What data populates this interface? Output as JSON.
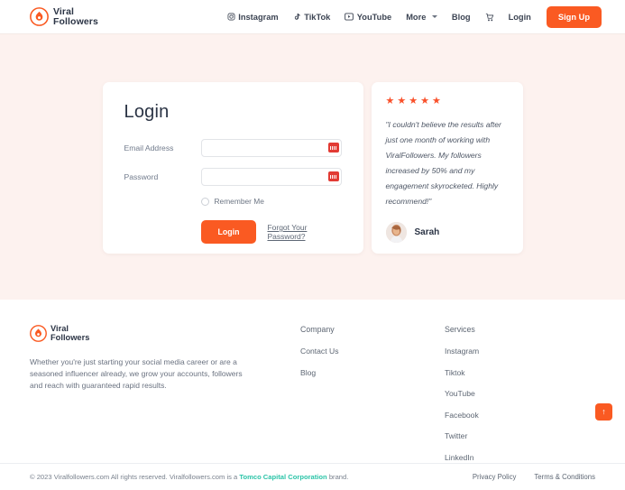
{
  "brand": {
    "name_line1": "Viral",
    "name_line2": "Followers",
    "accent_color": "#fa5a22",
    "logo_icon": "flame-droplet-icon"
  },
  "header": {
    "nav": [
      {
        "label": "Instagram",
        "icon": "instagram-icon"
      },
      {
        "label": "TikTok",
        "icon": "tiktok-icon"
      },
      {
        "label": "YouTube",
        "icon": "youtube-icon"
      },
      {
        "label": "More",
        "icon": "chevron-down-icon"
      },
      {
        "label": "Blog",
        "icon": ""
      },
      {
        "label": "",
        "icon": "cart-icon"
      },
      {
        "label": "Login",
        "icon": ""
      }
    ],
    "signup_label": "Sign Up"
  },
  "login": {
    "title": "Login",
    "email_label": "Email Address",
    "email_value": "",
    "email_placeholder": "",
    "password_label": "Password",
    "password_value": "",
    "password_placeholder": "",
    "remember_label": "Remember Me",
    "remember_checked": false,
    "submit_label": "Login",
    "forgot_label": "Forgot Your Password?",
    "field_icon": "password-manager-icon"
  },
  "testimonial": {
    "rating": 5,
    "star_glyph": "★",
    "quote": "\"I couldn't believe the results after just one month of working with ViralFollowers. My followers increased by 50% and my engagement skyrocketed. Highly recommend!\"",
    "author": "Sarah"
  },
  "footer": {
    "description": "Whether you're just starting your social media career or are a seasoned influencer already, we grow your accounts, followers and reach with guaranteed rapid results.",
    "company": {
      "title": "Company",
      "links": [
        "Contact Us",
        "Blog"
      ]
    },
    "services": {
      "title": "Services",
      "links": [
        "Instagram",
        "Tiktok",
        "YouTube",
        "Facebook",
        "Twitter",
        "LinkedIn"
      ]
    }
  },
  "bottom": {
    "copyright_before": "© 2023 Viralfollowers.com All rights reserved. Viralfollowers.com is a ",
    "copyright_link": "Tomco Capital Corporation",
    "copyright_after": " brand.",
    "link_color": "#2bc4a8",
    "privacy_label": "Privacy Policy",
    "terms_label": "Terms & Conditions"
  },
  "scroll_top": {
    "icon": "arrow-up-icon",
    "glyph": "↑"
  }
}
